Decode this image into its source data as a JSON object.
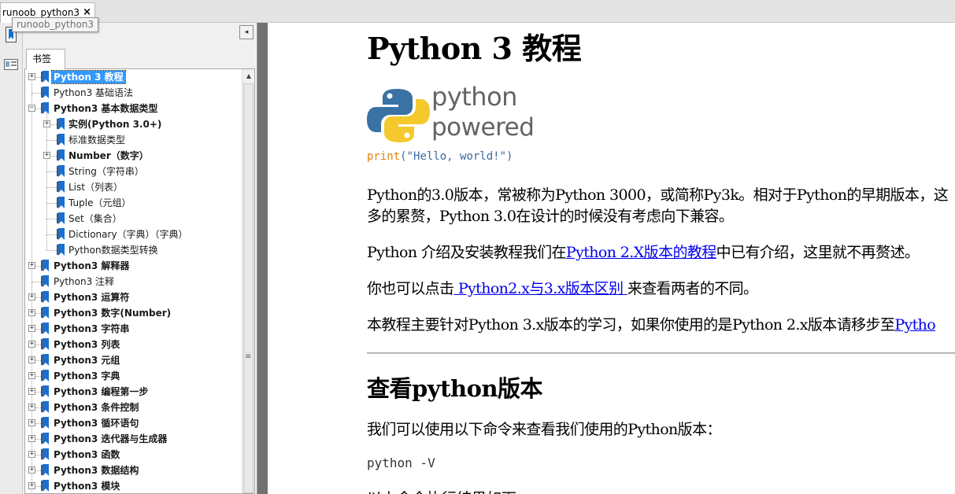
{
  "tab": {
    "title": "runoob_python3",
    "close": "×"
  },
  "tooltip": "runoob_python3",
  "panel": {
    "collapse_icon": "◂",
    "tab_label": "书签"
  },
  "tree": [
    {
      "label": "Python 3 教程",
      "bold": true,
      "selected": true,
      "level": 0,
      "expander": "+"
    },
    {
      "label": "Python3 基础语法",
      "bold": false,
      "level": 0,
      "expander": ""
    },
    {
      "label": "Python3 基本数据类型",
      "bold": true,
      "level": 0,
      "expander": "−"
    },
    {
      "label": "实例(Python 3.0+)",
      "bold": true,
      "level": 1,
      "expander": "+"
    },
    {
      "label": "标准数据类型",
      "bold": false,
      "level": 1,
      "expander": ""
    },
    {
      "label": "Number（数字）",
      "bold": true,
      "level": 1,
      "expander": "+"
    },
    {
      "label": "String（字符串）",
      "bold": false,
      "level": 1,
      "expander": ""
    },
    {
      "label": "List（列表）",
      "bold": false,
      "level": 1,
      "expander": ""
    },
    {
      "label": "Tuple（元组）",
      "bold": false,
      "level": 1,
      "expander": ""
    },
    {
      "label": "Set（集合）",
      "bold": false,
      "level": 1,
      "expander": ""
    },
    {
      "label": "Dictionary（字典）（字典）",
      "bold": false,
      "level": 1,
      "expander": ""
    },
    {
      "label": "Python数据类型转换",
      "bold": false,
      "level": 1,
      "expander": ""
    },
    {
      "label": "Python3 解释器",
      "bold": true,
      "level": 0,
      "expander": "+"
    },
    {
      "label": "Python3 注释",
      "bold": false,
      "level": 0,
      "expander": ""
    },
    {
      "label": "Python3 运算符",
      "bold": true,
      "level": 0,
      "expander": "+"
    },
    {
      "label": "Python3 数字(Number)",
      "bold": true,
      "level": 0,
      "expander": "+"
    },
    {
      "label": "Python3 字符串",
      "bold": true,
      "level": 0,
      "expander": "+"
    },
    {
      "label": "Python3 列表",
      "bold": true,
      "level": 0,
      "expander": "+"
    },
    {
      "label": "Python3 元组",
      "bold": true,
      "level": 0,
      "expander": "+"
    },
    {
      "label": "Python3 字典",
      "bold": true,
      "level": 0,
      "expander": "+"
    },
    {
      "label": "Python3 编程第一步",
      "bold": true,
      "level": 0,
      "expander": "+"
    },
    {
      "label": "Python3 条件控制",
      "bold": true,
      "level": 0,
      "expander": "+"
    },
    {
      "label": "Python3 循环语句",
      "bold": true,
      "level": 0,
      "expander": "+"
    },
    {
      "label": "Python3 迭代器与生成器",
      "bold": true,
      "level": 0,
      "expander": "+"
    },
    {
      "label": "Python3 函数",
      "bold": true,
      "level": 0,
      "expander": "+"
    },
    {
      "label": "Python3 数据结构",
      "bold": true,
      "level": 0,
      "expander": "+"
    },
    {
      "label": "Python3 模块",
      "bold": true,
      "level": 0,
      "expander": "+"
    }
  ],
  "doc": {
    "title": "Python 3 教程",
    "logo": {
      "word1": "python",
      "word2": "powered",
      "code_kw": "print",
      "code_str": "(\"Hello, world!\")"
    },
    "p1_line1": "Python的3.0版本，常被称为Python 3000，或简称Py3k。相对于Python的早期版本，这",
    "p1_line2": "多的累赘，Python 3.0在设计的时候没有考虑向下兼容。",
    "p2_before": "Python 介绍及安装教程我们在",
    "p2_link": "Python 2.X版本的教程",
    "p2_after": "中已有介绍，这里就不再赘述。",
    "p3_before": "你也可以点击",
    "p3_link": " Python2.x与3.x版本区别 ",
    "p3_after": "来查看两者的不同。",
    "p4_before": "本教程主要针对Python 3.x版本的学习，如果你使用的是Python 2.x版本请移步至",
    "p4_link": "Pytho",
    "h2": "查看python版本",
    "p5": "我们可以使用以下命令来查看我们使用的Python版本：",
    "code": "python -V",
    "partial": "以上命令执行结果如下："
  },
  "colors": {
    "bookmark": "#1a6fd0",
    "selection": "#3399ff",
    "link": "#0000ee",
    "splitter": "#717171"
  }
}
